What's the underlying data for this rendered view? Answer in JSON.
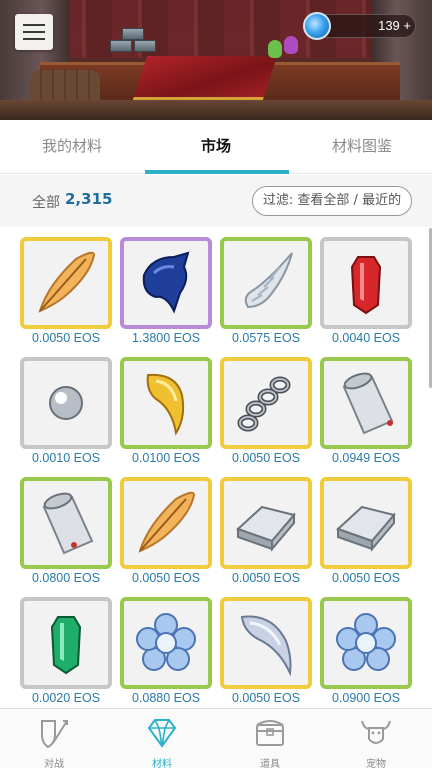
{
  "header": {
    "menu_icon": "hamburger-icon",
    "currency": {
      "icon": "blue-orb-icon",
      "amount": "139 +"
    }
  },
  "tabs": [
    {
      "label": "我的材料",
      "active": false
    },
    {
      "label": "市场",
      "active": true
    },
    {
      "label": "材料图鉴",
      "active": false
    }
  ],
  "filter": {
    "total_label": "全部",
    "total_count": "2,315",
    "button_label": "过滤: 查看全部 / 最近的"
  },
  "colors": {
    "accent": "#2bb2c8",
    "price_text": "#2a7aa8",
    "rarity_yellow": "#f0cc3c",
    "rarity_green": "#98c84c",
    "rarity_purple": "#b88ad8",
    "rarity_gray": "#c6c6c6"
  },
  "items": [
    {
      "icon": "golden-feather-icon",
      "rarity": "yellow",
      "price": "0.0050 EOS"
    },
    {
      "icon": "blue-scale-icon",
      "rarity": "purple",
      "price": "1.3800 EOS"
    },
    {
      "icon": "spiral-horn-icon",
      "rarity": "green",
      "price": "0.0575 EOS"
    },
    {
      "icon": "red-crystal-icon",
      "rarity": "gray",
      "price": "0.0040 EOS"
    },
    {
      "icon": "pearl-icon",
      "rarity": "gray",
      "price": "0.0010 EOS"
    },
    {
      "icon": "golden-fang-icon",
      "rarity": "green",
      "price": "0.0100 EOS"
    },
    {
      "icon": "chain-icon",
      "rarity": "yellow",
      "price": "0.0050 EOS"
    },
    {
      "icon": "silver-scroll-icon",
      "rarity": "green",
      "price": "0.0949 EOS"
    },
    {
      "icon": "silver-scroll-icon",
      "rarity": "green",
      "price": "0.0800 EOS"
    },
    {
      "icon": "golden-feather-icon",
      "rarity": "yellow",
      "price": "0.0050 EOS"
    },
    {
      "icon": "silver-ingot-icon",
      "rarity": "yellow",
      "price": "0.0050 EOS"
    },
    {
      "icon": "silver-ingot-icon",
      "rarity": "yellow",
      "price": "0.0050 EOS"
    },
    {
      "icon": "green-crystal-icon",
      "rarity": "gray",
      "price": "0.0020 EOS"
    },
    {
      "icon": "blue-flower-crystal-icon",
      "rarity": "green",
      "price": "0.0880 EOS"
    },
    {
      "icon": "silver-fang-icon",
      "rarity": "yellow",
      "price": "0.0050 EOS"
    },
    {
      "icon": "blue-flower-crystal-icon",
      "rarity": "green",
      "price": "0.0900 EOS"
    }
  ],
  "bottom_nav": [
    {
      "label": "对战",
      "icon": "shield-sword-icon",
      "active": false
    },
    {
      "label": "材料",
      "icon": "diamond-icon",
      "active": true
    },
    {
      "label": "道具",
      "icon": "treasure-chest-icon",
      "active": false
    },
    {
      "label": "宠物",
      "icon": "bull-head-icon",
      "active": false
    }
  ]
}
